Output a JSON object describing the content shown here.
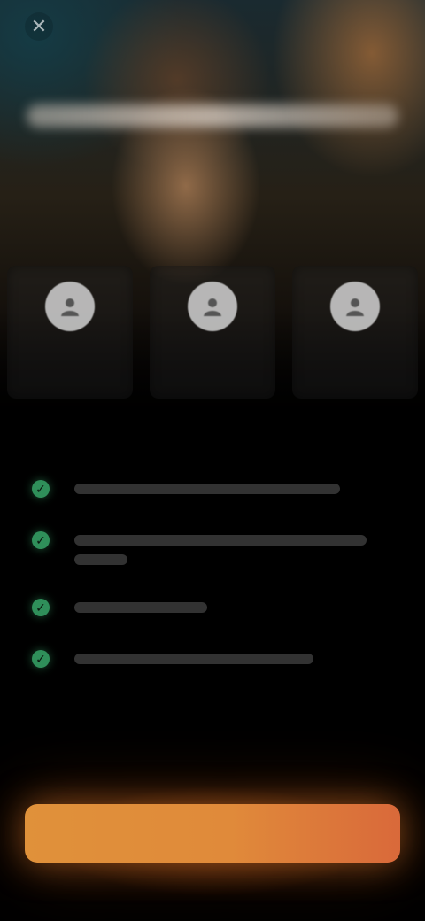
{
  "header": {
    "close_glyph": "✕"
  },
  "icons": {
    "close": "close-icon",
    "plan_1": "avatar-icon",
    "plan_2": "avatar-icon",
    "plan_3": "avatar-icon",
    "check": "check-icon"
  },
  "plans": [
    {
      "title": "",
      "subtitle": ""
    },
    {
      "title": "",
      "subtitle": ""
    },
    {
      "title": "",
      "subtitle": ""
    }
  ],
  "features": [
    {
      "text": ""
    },
    {
      "text": ""
    },
    {
      "text": ""
    },
    {
      "text": ""
    }
  ],
  "cta": {
    "label": ""
  },
  "footer": {
    "terms": ""
  },
  "colors": {
    "accent_start": "#e0913a",
    "accent_end": "#d9693a",
    "check_green": "#2f8f5a",
    "background": "#000000"
  }
}
